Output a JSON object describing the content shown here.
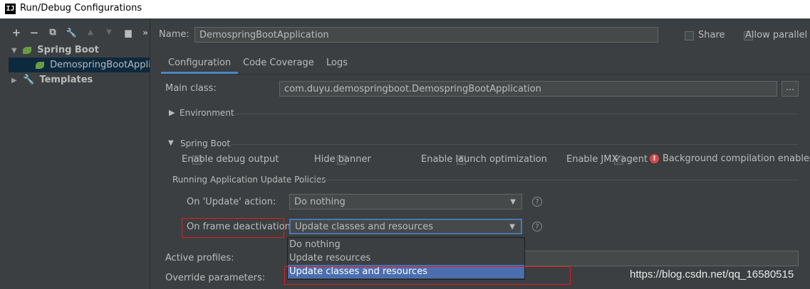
{
  "window": {
    "title": "Run/Debug Configurations"
  },
  "toolbar": {
    "add": "+",
    "remove": "−",
    "copy": "⧉",
    "edit": "🔧",
    "up": "▲",
    "down": "▼",
    "folder": "▆",
    "more": "»"
  },
  "tree": {
    "spring_boot": "Spring Boot",
    "app": "DemospringBootApplica",
    "templates": "Templates"
  },
  "header": {
    "name_label": "Name:",
    "name_value": "DemospringBootApplication",
    "share": "Share",
    "allow_parallel": "Allow parallel ru"
  },
  "tabs": [
    "Configuration",
    "Code Coverage",
    "Logs"
  ],
  "config": {
    "main_class_label": "Main class:",
    "main_class_value": "com.duyu.demospringboot.DemospringBootApplication",
    "browse": "...",
    "environment": "Environment",
    "spring_boot_section": "Spring Boot",
    "enable_debug": "Enable debug output",
    "hide_banner": "Hide banner",
    "enable_launch": "Enable launch optimization",
    "enable_jmx": "Enable JMX agent",
    "background_compilation": "Background compilation enabled",
    "policies_title": "Running Application Update Policies",
    "on_update_label": "On 'Update' action:",
    "on_update_value": "Do nothing",
    "on_frame_label": "On frame deactivation:",
    "on_frame_value": "Update classes and resources",
    "active_profiles_label": "Active profiles:",
    "override_label": "Override parameters:"
  },
  "popup": {
    "options": [
      "Do nothing",
      "Update resources",
      "Update classes and resources"
    ]
  },
  "watermark": "https://blog.csdn.net/qq_16580515",
  "colors": {
    "selection": "#4b6eaf",
    "highlight": "#e31c1c",
    "tab_underline": "#4a88c7"
  }
}
